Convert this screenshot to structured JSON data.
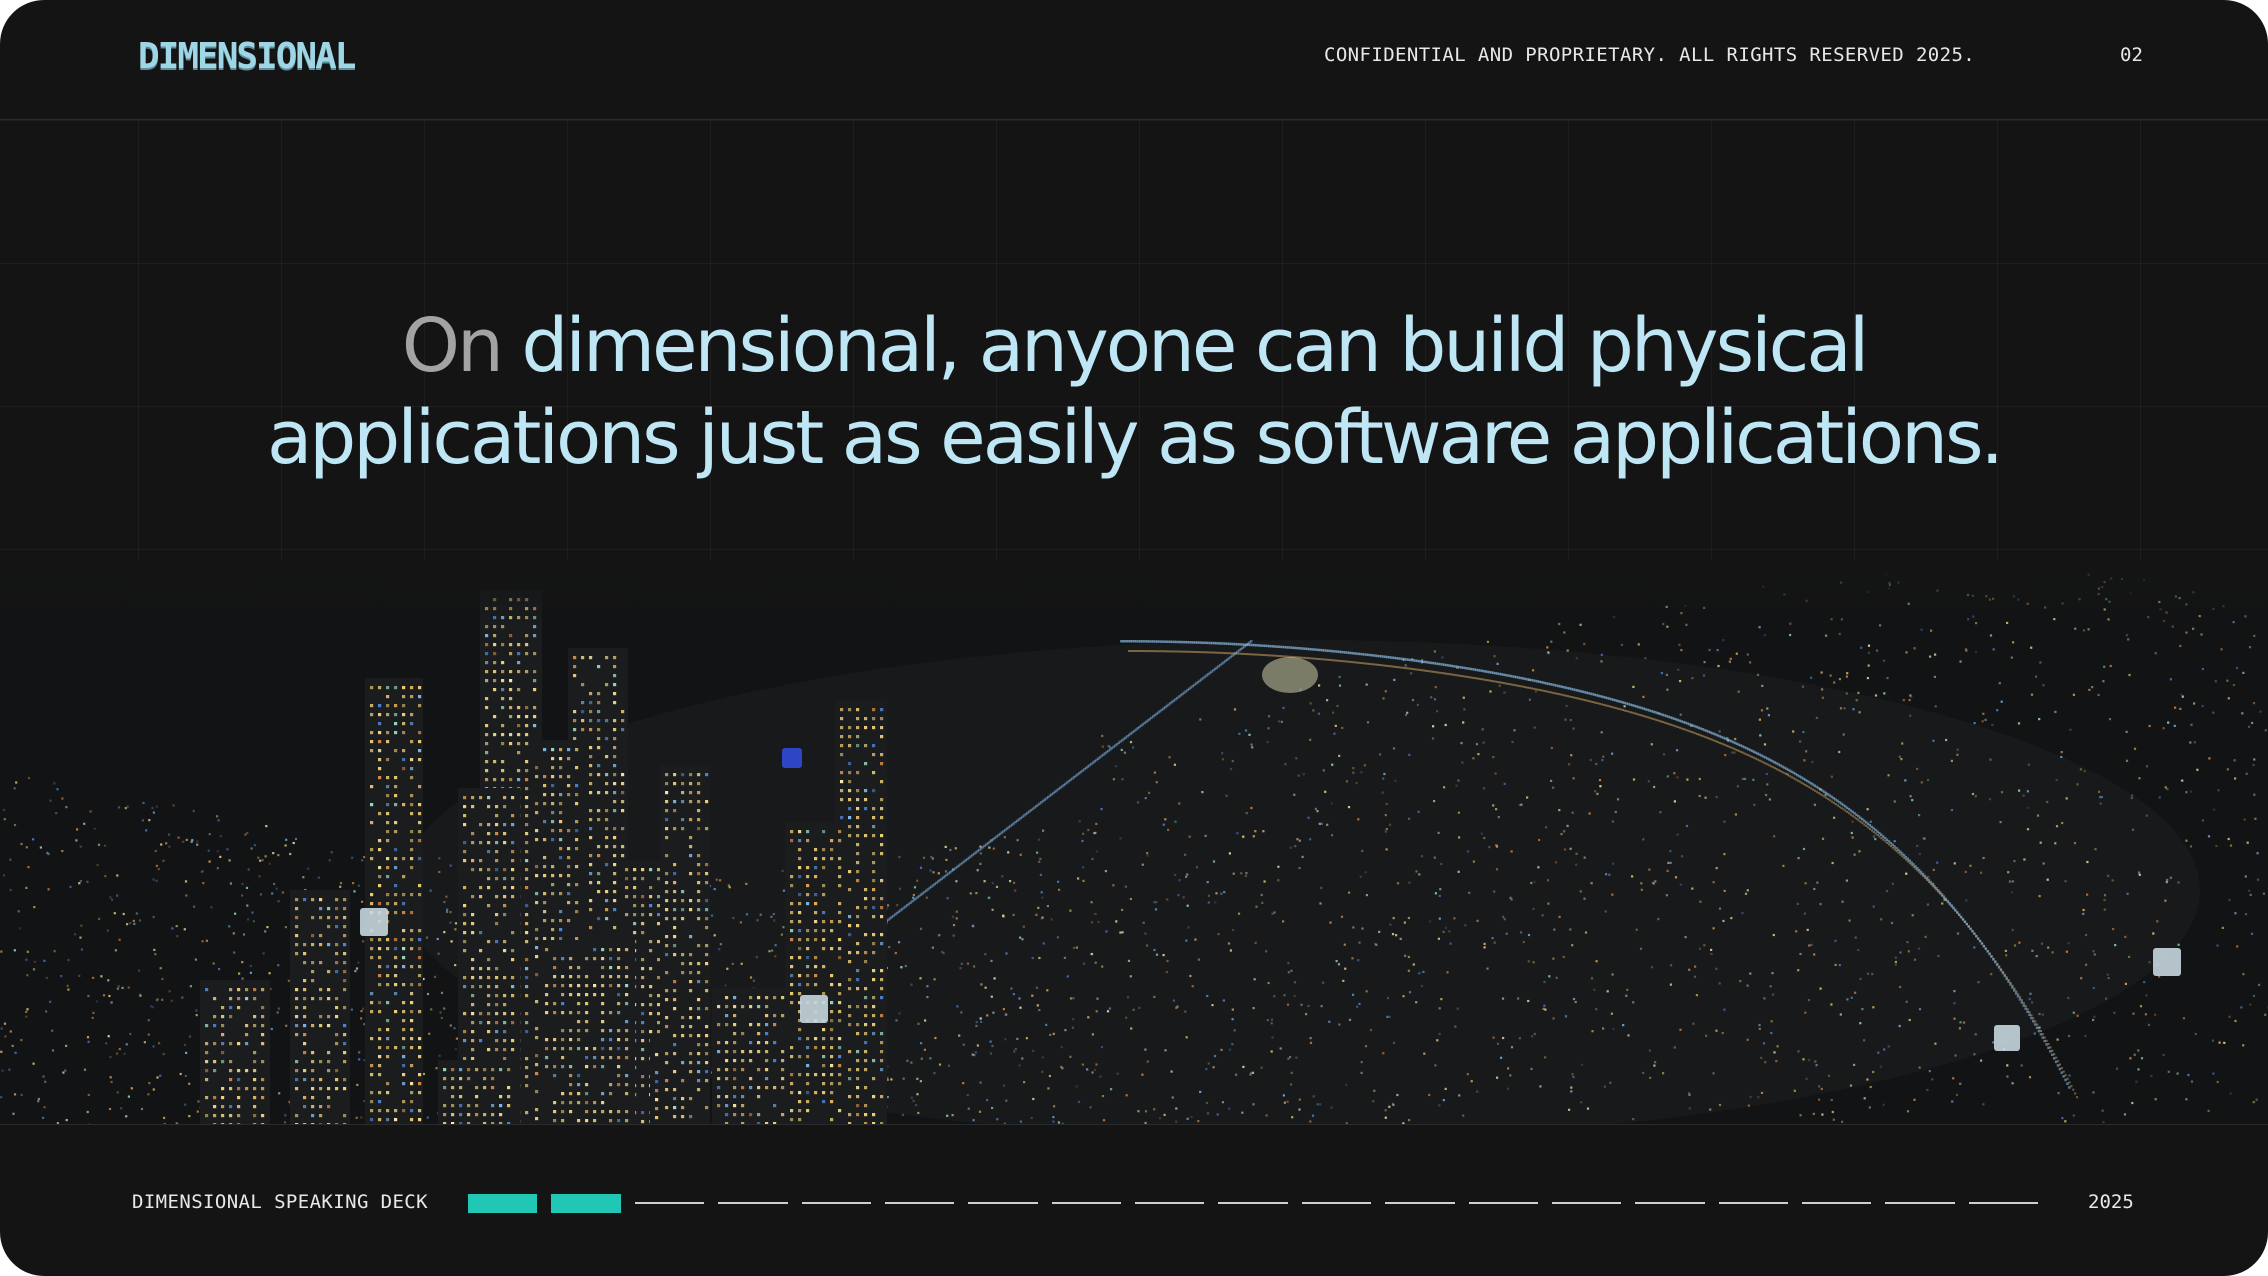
{
  "header": {
    "logo": "DIMENSIONAL",
    "confidential": "CONFIDENTIAL AND PROPRIETARY. ALL RIGHTS RESERVED 2025.",
    "page_number": "02"
  },
  "headline": {
    "line1_muted": "On",
    "line1_accent": "dimensional, anyone can build physical",
    "line2_accent": "applications just as easily as software applications."
  },
  "footer": {
    "deck_label": "DIMENSIONAL SPEAKING DECK",
    "year": "2025",
    "progress": {
      "total_segments": 19,
      "completed_segments": 2
    }
  },
  "colors": {
    "background": "#141415",
    "accent_text": "#bfe6f4",
    "muted_text": "#a3a3a5",
    "progress_active": "#1fc7b4",
    "progress_inactive": "#cfcfd1"
  },
  "image": {
    "icon": "night-city-aerial-image"
  }
}
